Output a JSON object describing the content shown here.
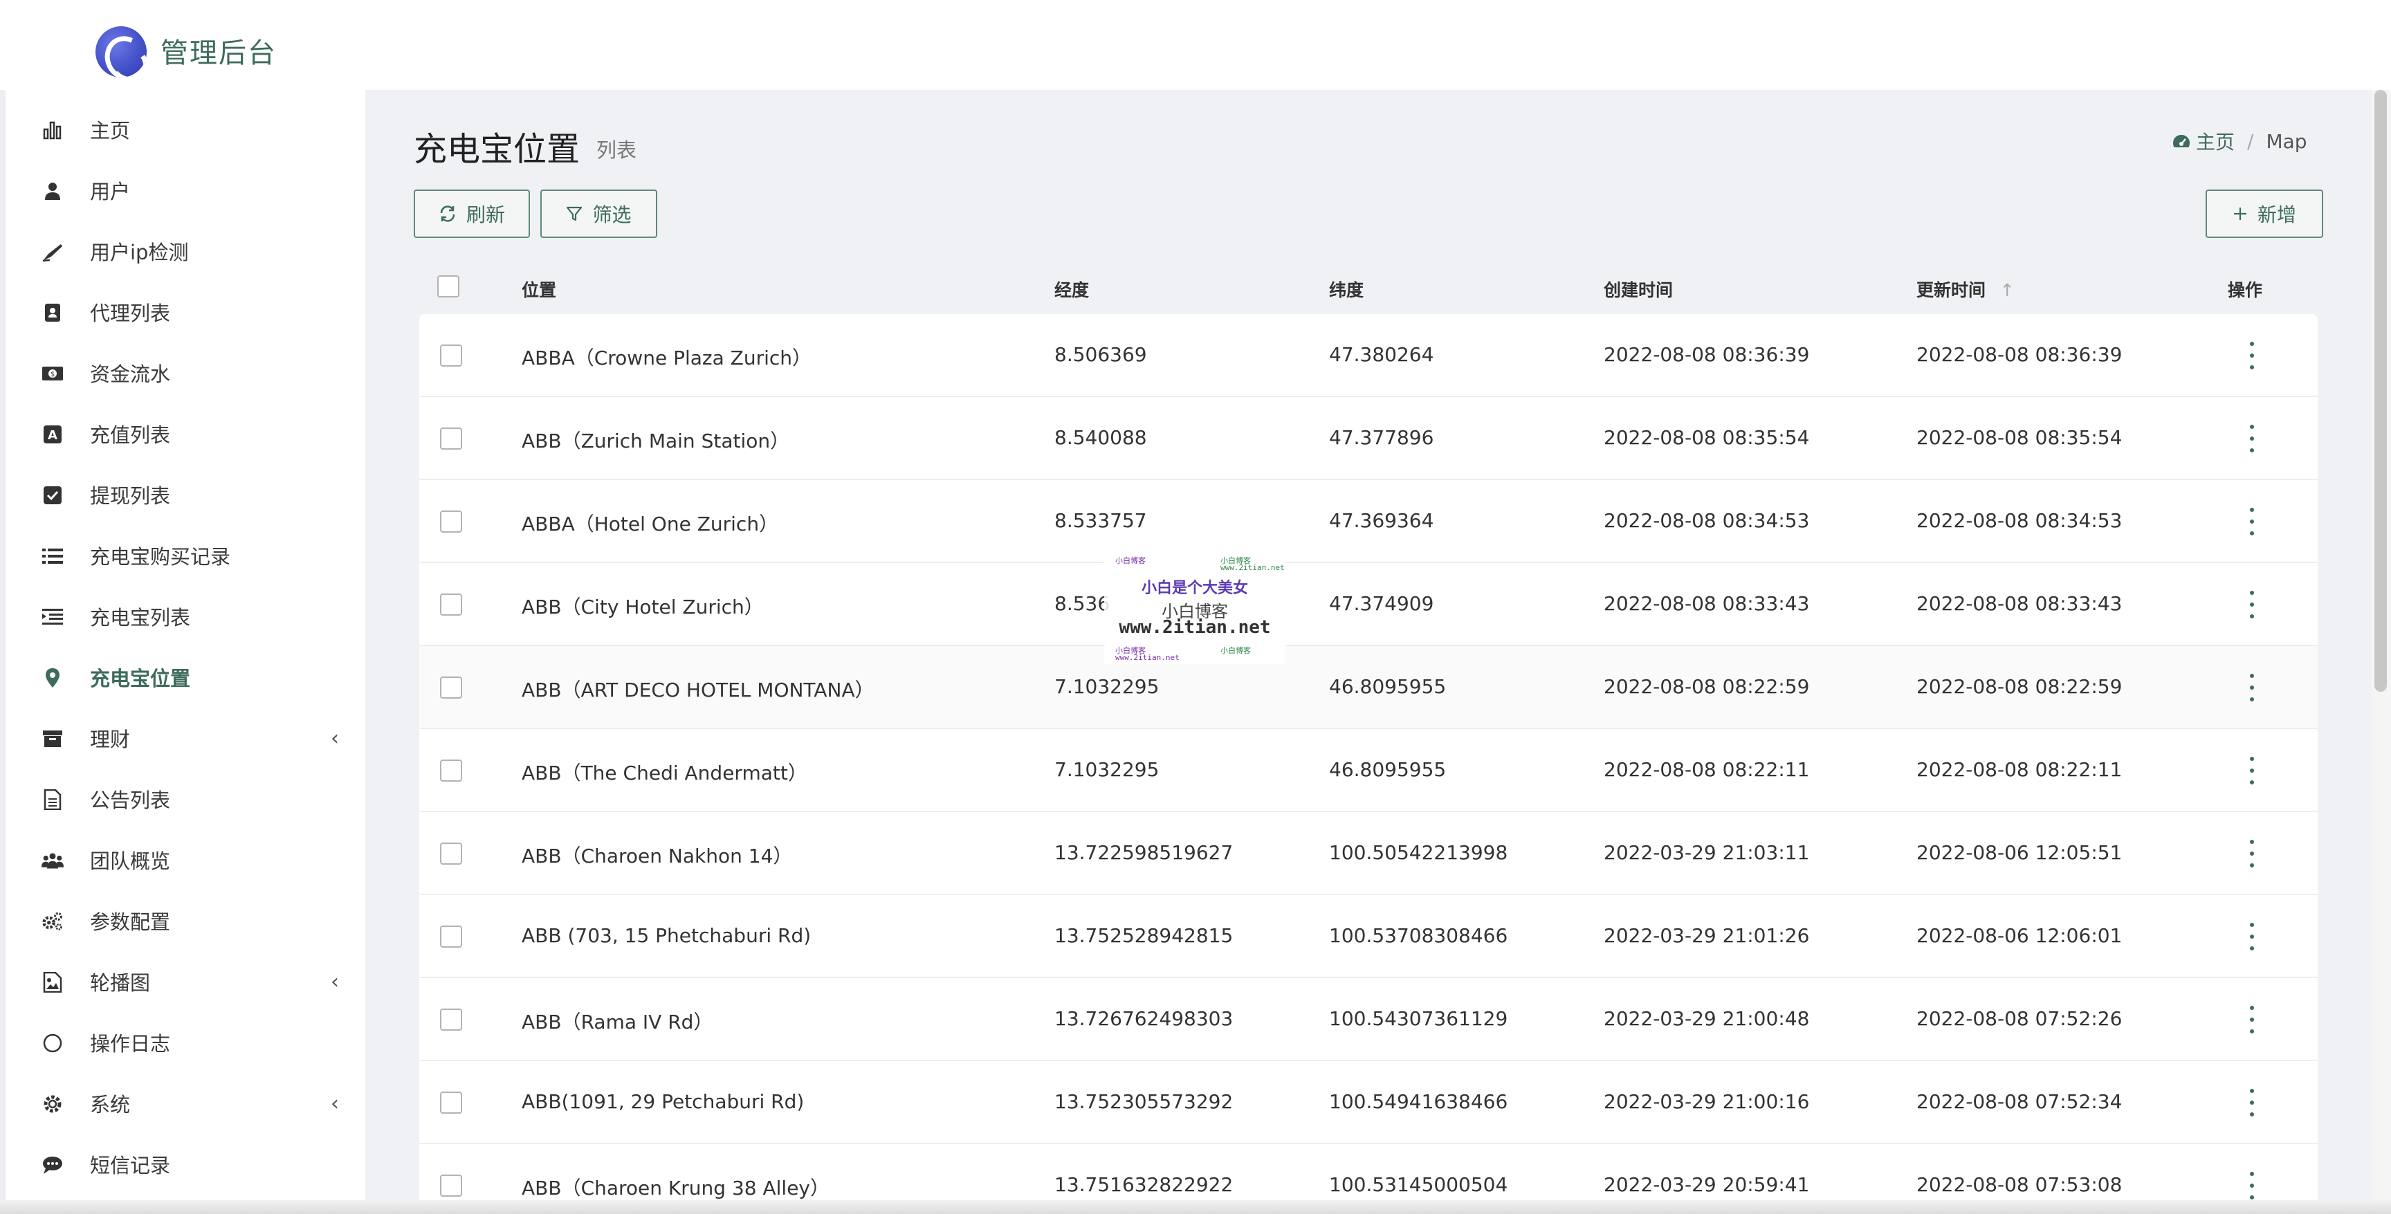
{
  "app": {
    "title": "管理后台"
  },
  "sidebar": {
    "items": [
      {
        "label": "主页",
        "icon": "bar-chart-icon"
      },
      {
        "label": "用户",
        "icon": "user-icon"
      },
      {
        "label": "用户ip检测",
        "icon": "pen-icon"
      },
      {
        "label": "代理列表",
        "icon": "contact-book-icon"
      },
      {
        "label": "资金流水",
        "icon": "money-icon"
      },
      {
        "label": "充值列表",
        "icon": "letter-a-box-icon"
      },
      {
        "label": "提现列表",
        "icon": "check-square-icon"
      },
      {
        "label": "充电宝购买记录",
        "icon": "list-icon"
      },
      {
        "label": "充电宝列表",
        "icon": "indent-list-icon"
      },
      {
        "label": "充电宝位置",
        "icon": "map-pin-icon"
      },
      {
        "label": "理财",
        "icon": "archive-icon"
      },
      {
        "label": "公告列表",
        "icon": "document-icon"
      },
      {
        "label": "团队概览",
        "icon": "users-icon"
      },
      {
        "label": "参数配置",
        "icon": "gears-icon"
      },
      {
        "label": "轮播图",
        "icon": "image-icon"
      },
      {
        "label": "操作日志",
        "icon": "circle-icon"
      },
      {
        "label": "系统",
        "icon": "gear-icon"
      },
      {
        "label": "短信记录",
        "icon": "comment-icon"
      }
    ],
    "active_index": 9,
    "expand_chevron": "‹"
  },
  "header": {
    "title": "充电宝位置",
    "subtitle": "列表",
    "breadcrumb": {
      "home": "主页",
      "separator": "/",
      "current": "Map"
    }
  },
  "toolbar": {
    "refresh_label": "刷新",
    "filter_label": "筛选",
    "add_label": "新增"
  },
  "table": {
    "columns": {
      "location": "位置",
      "longitude": "经度",
      "latitude": "纬度",
      "created": "创建时间",
      "updated": "更新时间",
      "actions": "操作"
    },
    "sort_indicator": "↑",
    "rows": [
      {
        "location": "ABBA（Crowne Plaza Zurich）",
        "longitude": "8.506369",
        "latitude": "47.380264",
        "created": "2022-08-08 08:36:39",
        "updated": "2022-08-08 08:36:39"
      },
      {
        "location": "ABB（Zurich Main Station）",
        "longitude": "8.540088",
        "latitude": "47.377896",
        "created": "2022-08-08 08:35:54",
        "updated": "2022-08-08 08:35:54"
      },
      {
        "location": "ABBA（Hotel One Zurich）",
        "longitude": "8.533757",
        "latitude": "47.369364",
        "created": "2022-08-08 08:34:53",
        "updated": "2022-08-08 08:34:53"
      },
      {
        "location": "ABB（City Hotel Zurich）",
        "longitude": "8.536",
        "latitude": "47.374909",
        "created": "2022-08-08 08:33:43",
        "updated": "2022-08-08 08:33:43"
      },
      {
        "location": "ABB（ART DECO HOTEL MONTANA）",
        "longitude": "7.1032295",
        "latitude": "46.8095955",
        "created": "2022-08-08 08:22:59",
        "updated": "2022-08-08 08:22:59"
      },
      {
        "location": "ABB（The Chedi Andermatt）",
        "longitude": "7.1032295",
        "latitude": "46.8095955",
        "created": "2022-08-08 08:22:11",
        "updated": "2022-08-08 08:22:11"
      },
      {
        "location": "ABB（Charoen Nakhon 14）",
        "longitude": "13.722598519627",
        "latitude": "100.50542213998",
        "created": "2022-03-29 21:03:11",
        "updated": "2022-08-06 12:05:51"
      },
      {
        "location": "ABB (703, 15 Phetchaburi Rd)",
        "longitude": "13.752528942815",
        "latitude": "100.53708308466",
        "created": "2022-03-29 21:01:26",
        "updated": "2022-08-06 12:06:01"
      },
      {
        "location": "ABB（Rama IV Rd）",
        "longitude": "13.726762498303",
        "latitude": "100.54307361129",
        "created": "2022-03-29 21:00:48",
        "updated": "2022-08-08 07:52:26"
      },
      {
        "location": "ABB(1091, 29 Petchaburi Rd)",
        "longitude": "13.752305573292",
        "latitude": "100.54941638466",
        "created": "2022-03-29 21:00:16",
        "updated": "2022-08-08 07:52:34"
      },
      {
        "location": "ABB（Charoen Krung 38 Alley）",
        "longitude": "13.751632822922",
        "latitude": "100.53145000504",
        "created": "2022-03-29 20:59:41",
        "updated": "2022-08-08 07:53:08"
      }
    ]
  },
  "watermark": {
    "line1": "小白是个大美女",
    "line2": "小白博客",
    "line3": "www.2itian.net",
    "tiny_left": "小白博客",
    "tiny_right": "小白博客",
    "tiny_url": "www.2itian.net"
  },
  "colors": {
    "accent": "#3d6b5c",
    "background": "#f0f1f5",
    "logo": "#4452c9"
  }
}
